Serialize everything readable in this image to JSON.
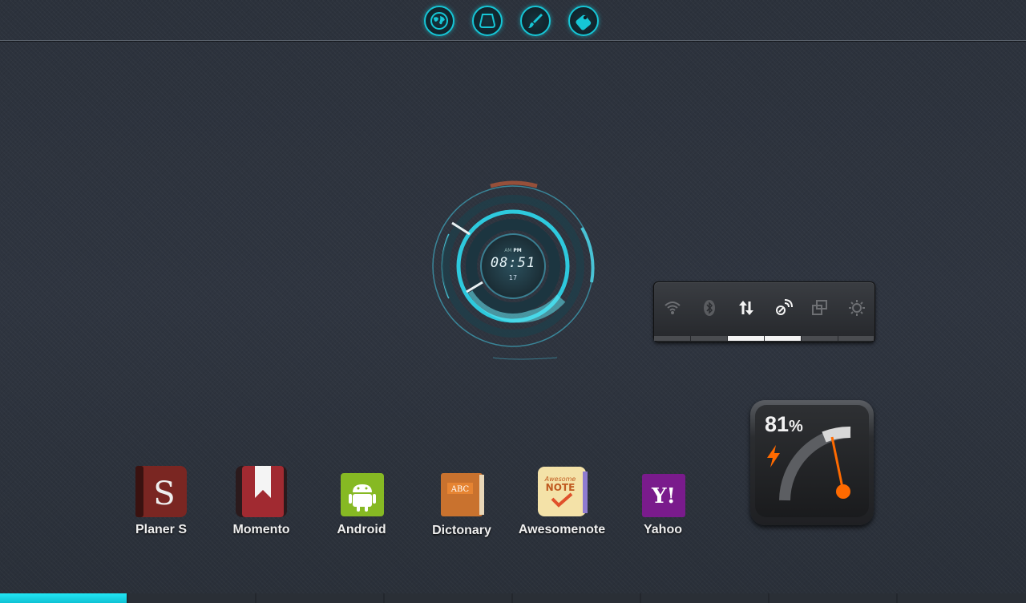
{
  "top_dock": {
    "icons": [
      {
        "name": "globe-icon"
      },
      {
        "name": "monitor-icon"
      },
      {
        "name": "brush-icon"
      },
      {
        "name": "tag-icon"
      }
    ],
    "accent": "#16c6d6"
  },
  "clock": {
    "am": "AM",
    "pm": "PM",
    "time": "08:51",
    "day": "17",
    "accent": "#2ec9dd"
  },
  "toggles": [
    {
      "name": "wifi-icon",
      "on": false
    },
    {
      "name": "bluetooth-icon",
      "on": false
    },
    {
      "name": "mobile-data-icon",
      "on": true
    },
    {
      "name": "gps-icon",
      "on": true
    },
    {
      "name": "auto-rotate-icon",
      "on": false
    },
    {
      "name": "brightness-icon",
      "on": false
    }
  ],
  "battery": {
    "value": "81",
    "unit": "%",
    "level": 0.81,
    "charging": true,
    "needle_color": "#ff6a00"
  },
  "apps": [
    {
      "label": "Planer S",
      "icon": "planer-s-icon"
    },
    {
      "label": "Momento",
      "icon": "momento-icon"
    },
    {
      "label": "Android",
      "icon": "android-icon"
    },
    {
      "label": "Dictonary",
      "icon": "dictionary-icon"
    },
    {
      "label": "Awesomenote",
      "icon": "awesomenote-icon"
    },
    {
      "label": "Yahoo",
      "icon": "yahoo-icon"
    }
  ],
  "app_icon_text": {
    "planer": "S",
    "dictionary": "ABC",
    "awesomenote_top": "Awesome",
    "awesomenote_bottom": "NOTE",
    "yahoo": "Y!"
  },
  "pager": {
    "pages": 8,
    "active": 1,
    "accent": "#1ad6e6"
  }
}
